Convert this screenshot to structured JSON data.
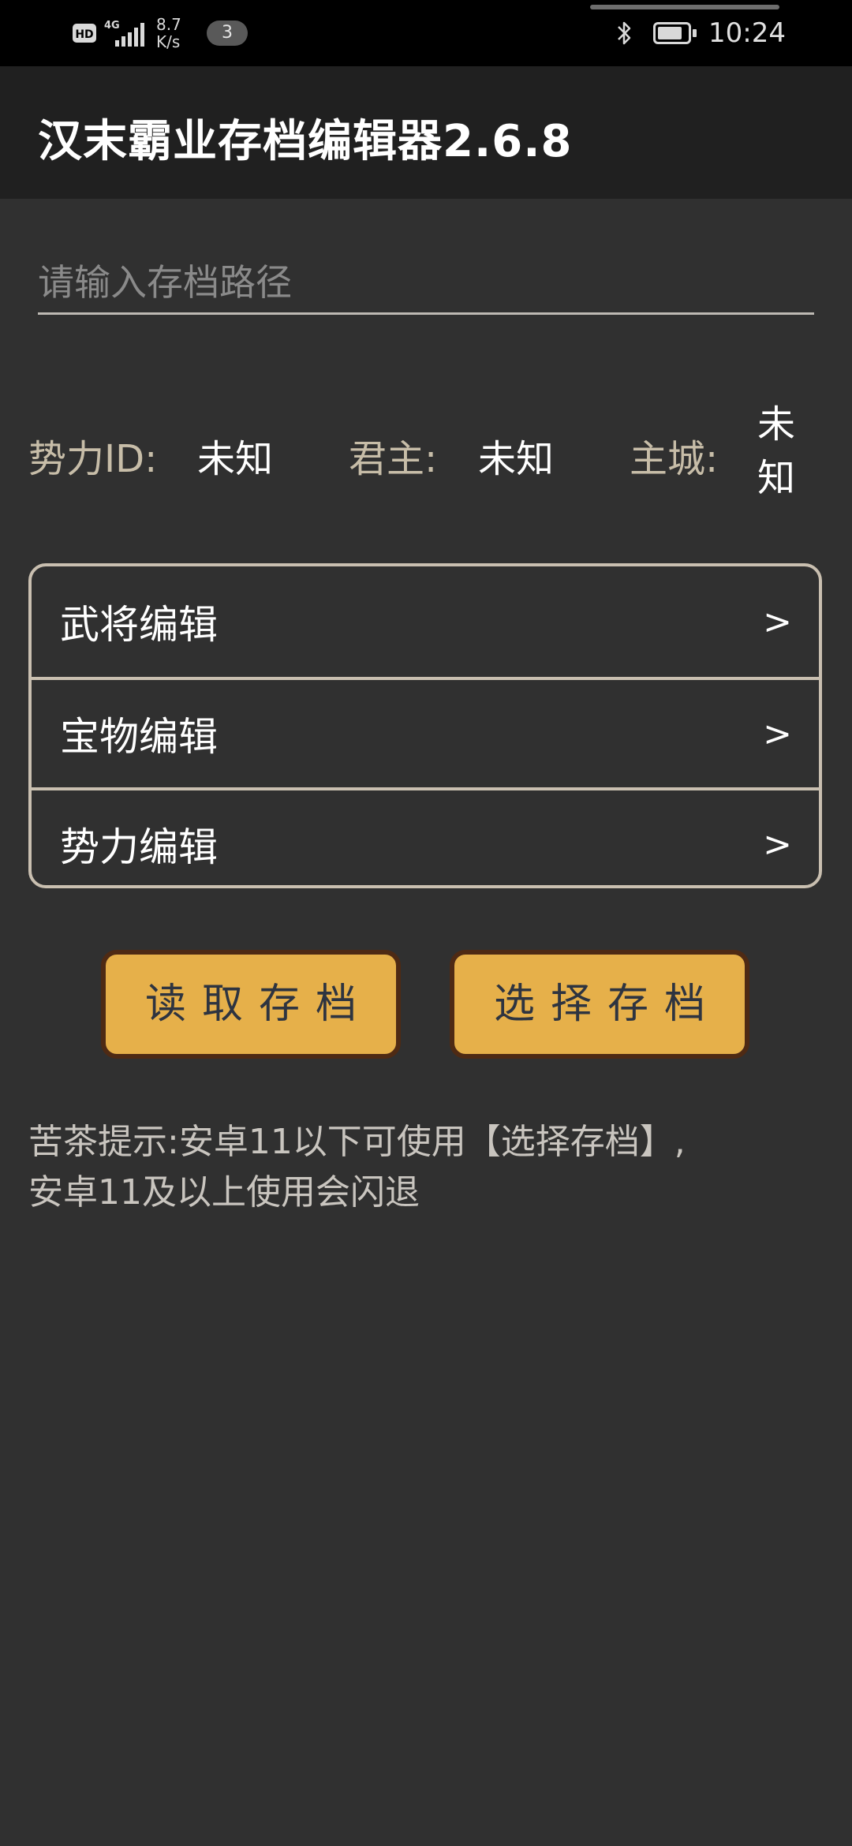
{
  "status_bar": {
    "hd": "HD",
    "network": "4G",
    "speed_value": "8.7",
    "speed_unit": "K/s",
    "notification_count": "3",
    "time": "10:24"
  },
  "app": {
    "title": "汉末霸业存档编辑器2.6.8"
  },
  "path_input": {
    "value": "",
    "placeholder": "请输入存档路径"
  },
  "info": {
    "faction_id_label": "势力ID:",
    "faction_id_value": "未知",
    "lord_label": "君主:",
    "lord_value": "未知",
    "capital_label": "主城:",
    "capital_value": "未知"
  },
  "menu": {
    "items": [
      {
        "label": "武将编辑",
        "arrow": ">"
      },
      {
        "label": "宝物编辑",
        "arrow": ">"
      },
      {
        "label": "势力编辑",
        "arrow": ">"
      }
    ]
  },
  "buttons": {
    "read_save": "读取存档",
    "select_save": "选择存档"
  },
  "tip": {
    "line1": "苦茶提示:安卓11以下可使用【选择存档】,",
    "line2": "安卓11及以上使用会闪退"
  },
  "colors": {
    "background": "#303030",
    "app_bar": "#202020",
    "button_fill": "#e6b04a",
    "button_border": "#4e2a14",
    "label": "#c7bda8"
  }
}
